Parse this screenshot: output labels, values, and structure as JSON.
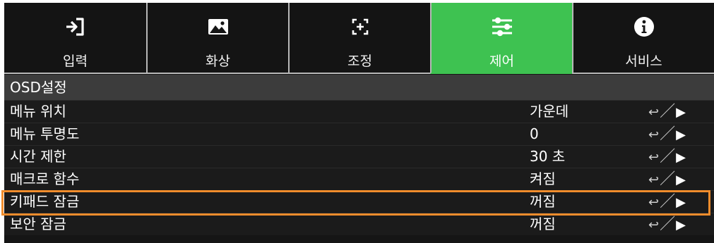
{
  "tabs": [
    {
      "label": "입력",
      "icon": "input-icon",
      "active": false
    },
    {
      "label": "화상",
      "icon": "image-icon",
      "active": false
    },
    {
      "label": "조정",
      "icon": "adjust-icon",
      "active": false
    },
    {
      "label": "제어",
      "icon": "sliders-icon",
      "active": true
    },
    {
      "label": "서비스",
      "icon": "info-icon",
      "active": false
    }
  ],
  "section": {
    "title": "OSD설정"
  },
  "rows": [
    {
      "name": "메뉴 위치",
      "value": "가운데",
      "action": "↩／▶"
    },
    {
      "name": "메뉴 투명도",
      "value": "0",
      "action": "↩／▶"
    },
    {
      "name": "시간 제한",
      "value": "30 초",
      "action": "↩／▶"
    },
    {
      "name": "매크로 함수",
      "value": "켜짐",
      "action": "↩／▶"
    },
    {
      "name": "키패드 잠금",
      "value": "꺼짐",
      "action": "↩／▶"
    },
    {
      "name": "보안 잠금",
      "value": "꺼짐",
      "action": "↩／▶"
    }
  ],
  "colors": {
    "active_tab": "#3ec251",
    "highlight_border": "#f08c2c",
    "background": "#151515"
  }
}
